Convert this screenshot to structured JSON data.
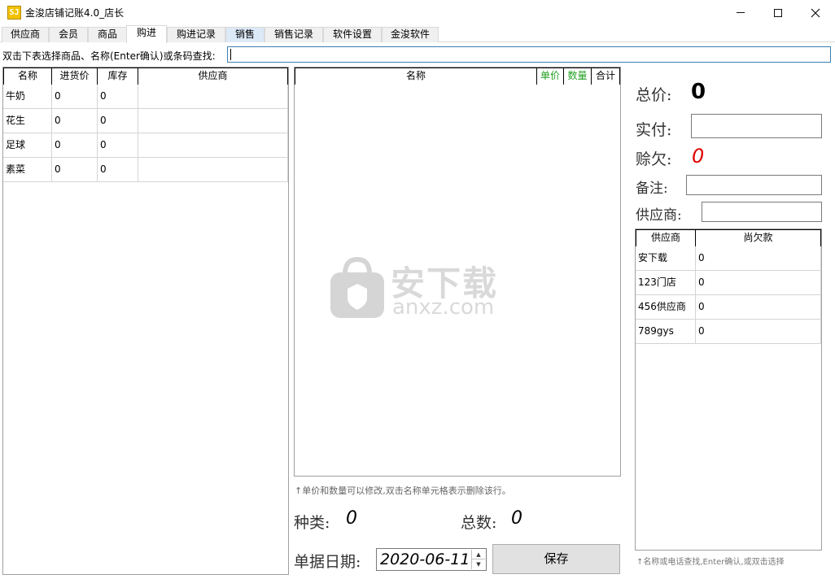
{
  "window": {
    "title": "金浚店铺记账4.0_店长",
    "icon_text": "SJ"
  },
  "tabs": [
    {
      "label": "供应商"
    },
    {
      "label": "会员"
    },
    {
      "label": "商品"
    },
    {
      "label": "购进"
    },
    {
      "label": "购进记录"
    },
    {
      "label": "销售"
    },
    {
      "label": "销售记录"
    },
    {
      "label": "软件设置"
    },
    {
      "label": "金浚软件"
    }
  ],
  "active_tab": "购进",
  "search": {
    "label": "双击下表选择商品、名称(Enter确认)或条码查找:",
    "value": ""
  },
  "product_table": {
    "columns": [
      "名称",
      "进货价",
      "库存",
      "供应商"
    ],
    "rows": [
      [
        "牛奶",
        "0",
        "0",
        ""
      ],
      [
        "花生",
        "0",
        "0",
        ""
      ],
      [
        "足球",
        "0",
        "0",
        ""
      ],
      [
        "素菜",
        "0",
        "0",
        ""
      ]
    ]
  },
  "order_table": {
    "columns": [
      "名称",
      "单价",
      "数量",
      "合计"
    ],
    "hint": "↑单价和数量可以修改,双击名称单元格表示删除该行。",
    "kinds_label": "种类:",
    "kinds_value": "0",
    "count_label": "总数:",
    "count_value": "0",
    "date_label": "单据日期:",
    "date_value": "2020-06-11",
    "save_label": "保存"
  },
  "summary": {
    "total_label": "总价:",
    "total_value": "0",
    "paid_label": "实付:",
    "owe_label": "赊欠:",
    "owe_value": "0",
    "note_label": "备注:",
    "supplier_label": "供应商:"
  },
  "supplier_table": {
    "columns": [
      "供应商",
      "尚欠款"
    ],
    "rows": [
      [
        "安下载",
        "0"
      ],
      [
        "123门店",
        "0"
      ],
      [
        "456供应商",
        "0"
      ],
      [
        "789gys",
        "0"
      ]
    ],
    "hint": "↑名称或电话查找,Enter确认,或双击选择"
  },
  "watermark": {
    "cn": "安下载",
    "en": "anxz.com"
  },
  "colors": {
    "accent_green": "#22a022",
    "owe_red": "#e00000",
    "tab_highlight": "#dce9f7"
  }
}
